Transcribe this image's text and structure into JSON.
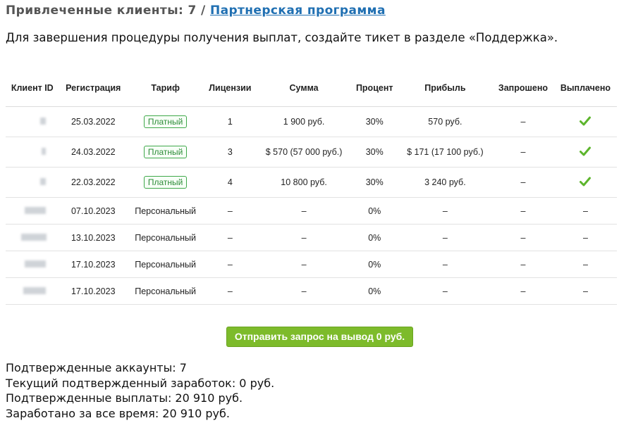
{
  "header": {
    "title_prefix": "Привлеченные клиенты: 7 /",
    "partner_link": "Партнерская программа"
  },
  "notice": "Для завершения процедуры получения выплат, создайте тикет в разделе «Поддержка».",
  "table": {
    "columns": [
      "Клиент ID",
      "Регистрация",
      "Тариф",
      "Лицензии",
      "Сумма",
      "Процент",
      "Прибыль",
      "Запрошено",
      "Выплачено"
    ],
    "rows": [
      {
        "date": "25.03.2022",
        "plan": "Платный",
        "licenses": "1",
        "sum": "1 900 руб.",
        "percent": "30%",
        "profit": "570 руб.",
        "requested": "–",
        "paid": "check-icon"
      },
      {
        "date": "24.03.2022",
        "plan": "Платный",
        "licenses": "3",
        "sum": "$ 570 (57 000 руб.)",
        "percent": "30%",
        "profit": "$ 171 (17 100 руб.)",
        "requested": "–",
        "paid": "check-icon"
      },
      {
        "date": "22.03.2022",
        "plan": "Платный",
        "licenses": "4",
        "sum": "10 800 руб.",
        "percent": "30%",
        "profit": "3 240 руб.",
        "requested": "–",
        "paid": "check-icon"
      },
      {
        "date": "07.10.2023",
        "plan": "Персональный",
        "licenses": "–",
        "sum": "–",
        "percent": "0%",
        "profit": "–",
        "requested": "–",
        "paid": "–"
      },
      {
        "date": "13.10.2023",
        "plan": "Персональный",
        "licenses": "–",
        "sum": "–",
        "percent": "0%",
        "profit": "–",
        "requested": "–",
        "paid": "–"
      },
      {
        "date": "17.10.2023",
        "plan": "Персональный",
        "licenses": "–",
        "sum": "–",
        "percent": "0%",
        "profit": "–",
        "requested": "–",
        "paid": "–"
      },
      {
        "date": "17.10.2023",
        "plan": "Персональный",
        "licenses": "–",
        "sum": "–",
        "percent": "0%",
        "profit": "–",
        "requested": "–",
        "paid": "–"
      }
    ]
  },
  "withdraw_button": "Отправить запрос на вывод 0 руб.",
  "stats": [
    "Подтвержденные аккаунты: 7",
    "Текущий подтвержденный заработок: 0 руб.",
    "Подтвержденные выплаты: 20 910 руб.",
    "Заработано за все время: 20 910 руб."
  ],
  "colors": {
    "paid_badge": "#2d8b38",
    "check": "#5cb52c",
    "button": "#7dbb2b",
    "link": "#1f6fb2"
  }
}
